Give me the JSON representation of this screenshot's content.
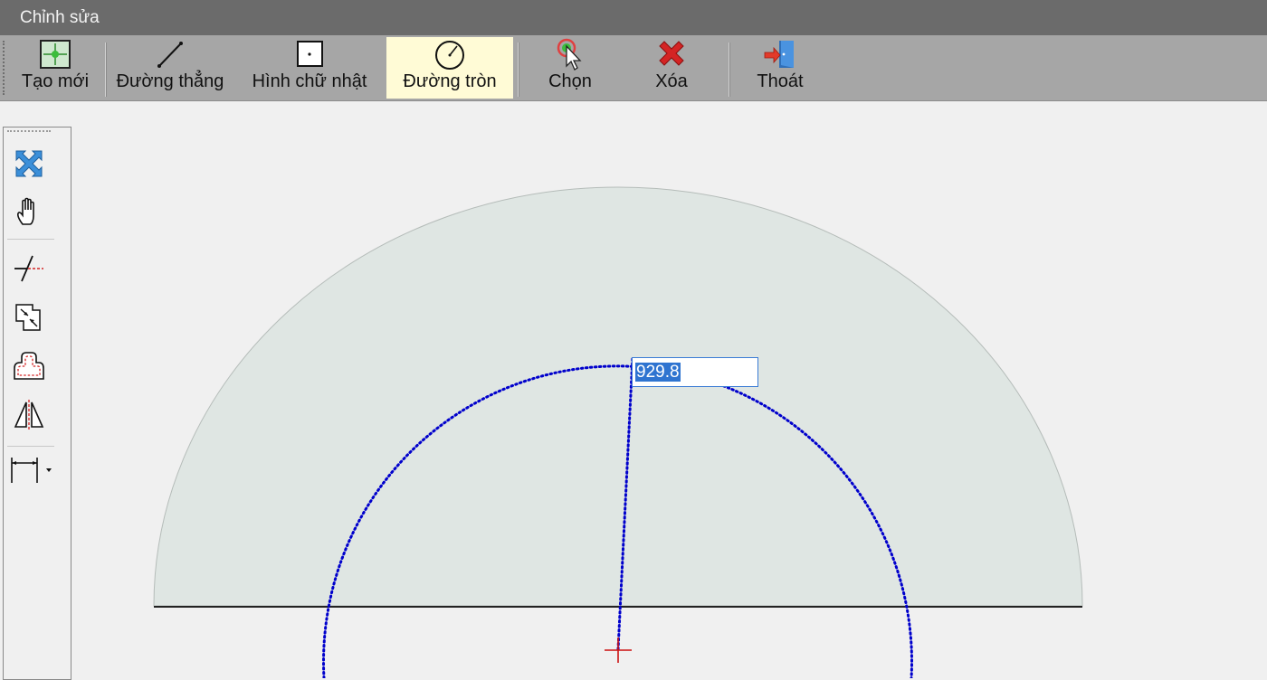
{
  "window": {
    "title": "Chỉnh sửa"
  },
  "toolbar": {
    "items": [
      {
        "label": "Tạo mới",
        "icon": "new-sheet-icon"
      },
      {
        "label": "Đường thẳng",
        "icon": "line-icon"
      },
      {
        "label": "Hình chữ nhật",
        "icon": "rectangle-icon"
      },
      {
        "label": "Đường tròn",
        "icon": "circle-icon",
        "active": true
      },
      {
        "label": "Chọn",
        "icon": "select-cursor-icon"
      },
      {
        "label": "Xóa",
        "icon": "delete-x-icon"
      },
      {
        "label": "Thoát",
        "icon": "exit-door-icon"
      }
    ]
  },
  "sidebar": {
    "tools": [
      "zoom-extents-icon",
      "pan-hand-icon",
      "trim-icon",
      "offset-icon",
      "fillet-icon",
      "mirror-icon",
      "dimension-icon"
    ]
  },
  "drawing": {
    "radius_input": {
      "value": "929.8",
      "selected": true
    },
    "colors": {
      "shape_fill": "#dfe6e3",
      "shape_stroke": "#b5bcb9",
      "preview_circle": "#0000cc",
      "center_mark": "#cc1111",
      "active_tool": "#fffbd6"
    }
  }
}
